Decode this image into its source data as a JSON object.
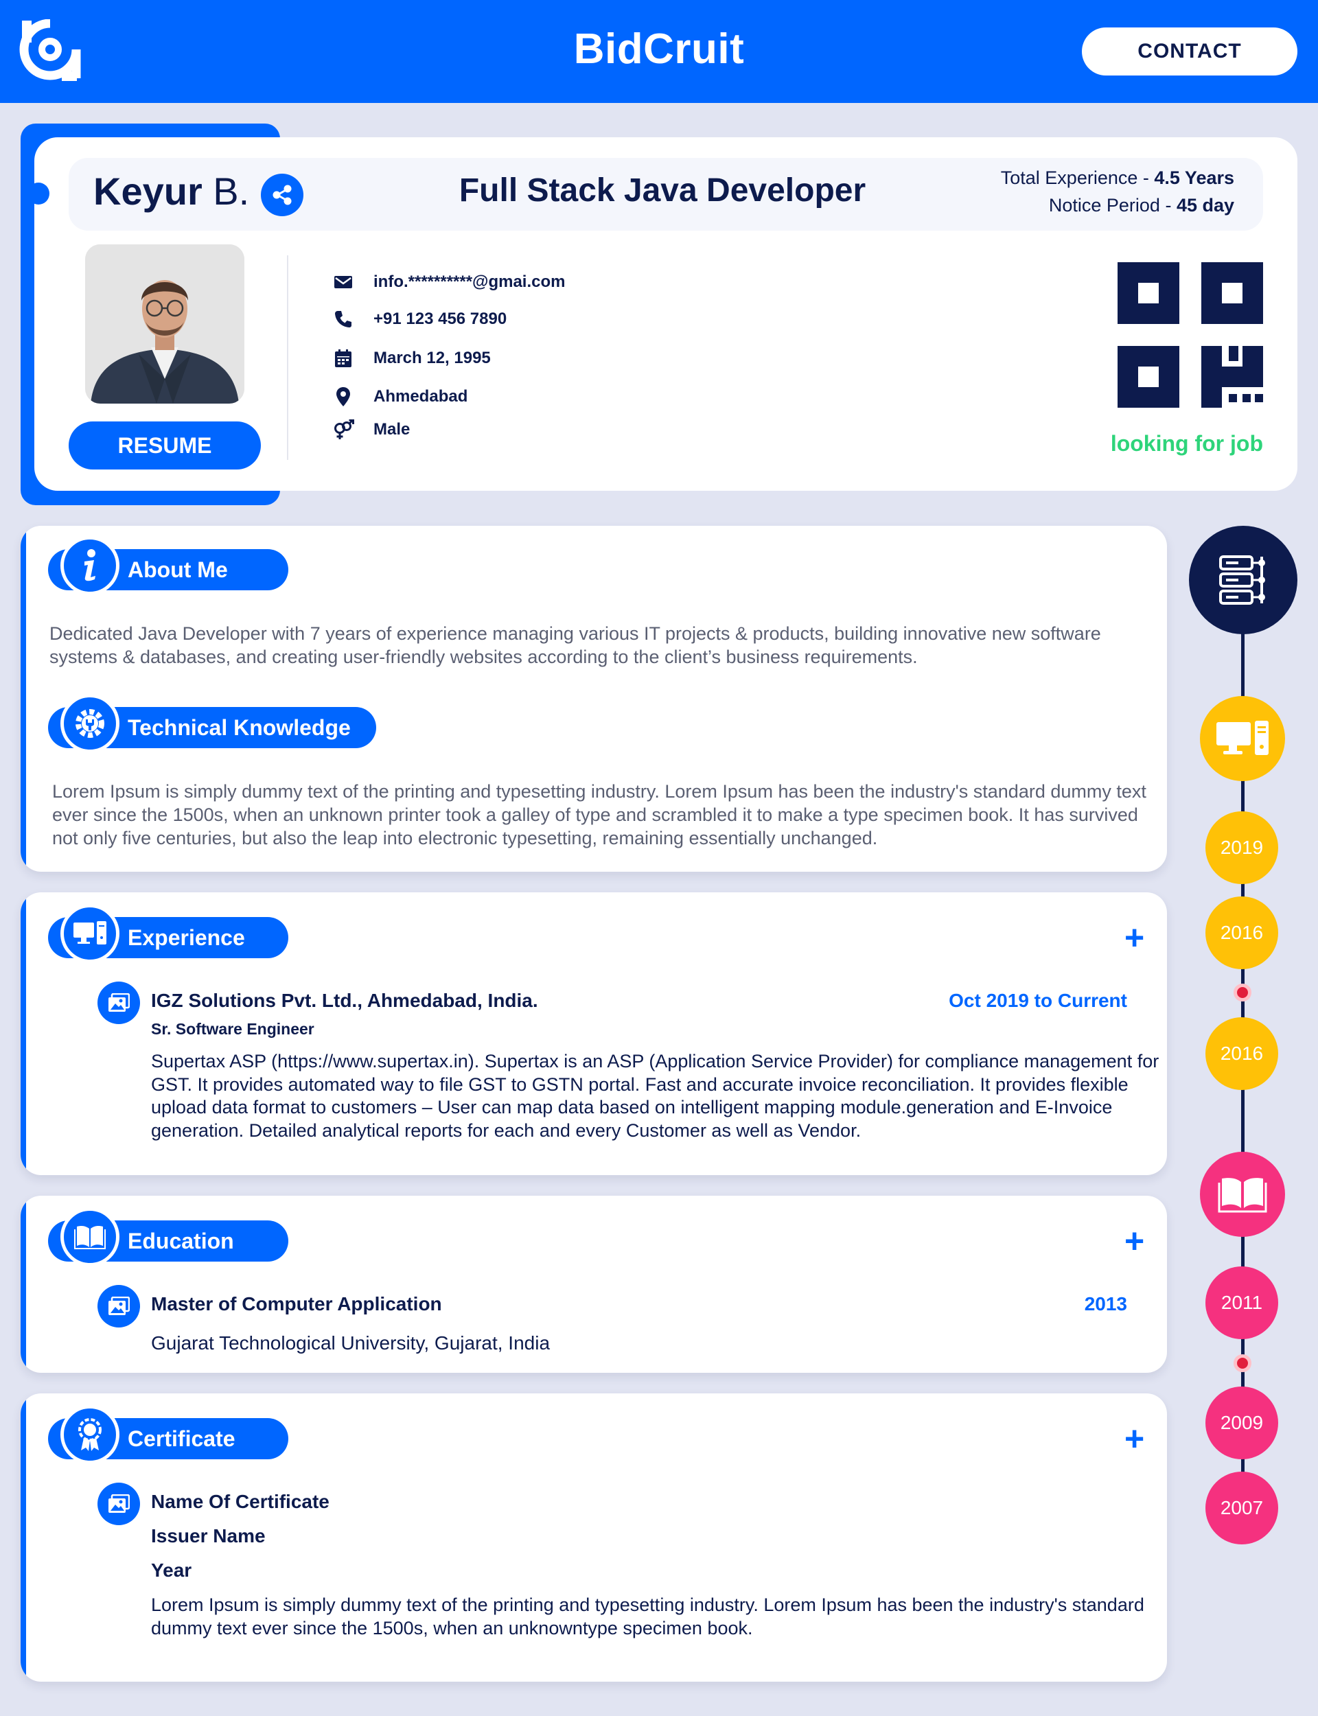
{
  "header": {
    "brand": "BidCruit",
    "contact_label": "CONTACT"
  },
  "profile": {
    "first_name": "Keyur",
    "last_initial": " B.",
    "title": "Full Stack Java Developer",
    "experience_label": "Total Experience - ",
    "experience_value": "4.5 Years",
    "notice_label": "Notice Period - ",
    "notice_value": "45 day",
    "email": "info.**********@gmai.com",
    "phone": "+91 123 456 7890",
    "dob": "March 12, 1995",
    "city": "Ahmedabad",
    "gender": "Male",
    "resume_label": "RESUME",
    "status": "looking for job"
  },
  "about": {
    "heading": "About Me",
    "text": "Dedicated Java Developer with 7 years of experience managing various IT projects & products, building innovative new software systems & databases, and creating user-friendly websites according to the client’s business requirements."
  },
  "technical": {
    "heading": "Technical Knowledge",
    "text": "Lorem Ipsum is simply dummy text of the printing and typesetting industry. Lorem Ipsum has been the industry's standard dummy text ever since the 1500s, when an unknown printer took a galley of type and scrambled it to make a type specimen book. It has survived not only five centuries, but also the leap into electronic typesetting, remaining essentially unchanged."
  },
  "experience": {
    "heading": "Experience",
    "add": "+",
    "company": "IGZ Solutions Pvt. Ltd., Ahmedabad, India.",
    "period": "Oct 2019 to Current",
    "position": "Sr. Software Engineer",
    "description": "Supertax ASP (https://www.supertax.in). Supertax is an ASP (Application Service Provider) for compliance management for GST. It provides automated way to file GST to GSTN portal. Fast and accurate invoice reconciliation. It provides flexible upload data format to customers – User can map data based on intelligent mapping module.generation and E-Invoice generation. Detailed analytical reports for each and every Customer as well as Vendor."
  },
  "education": {
    "heading": "Education",
    "add": "+",
    "degree": "Master of Computer Application",
    "year": "2013",
    "school": "Gujarat Technological University, Gujarat, India"
  },
  "certificate": {
    "heading": "Certificate",
    "add": "+",
    "name": "Name Of Certificate",
    "issuer": "Issuer Name",
    "year": "Year",
    "description": "Lorem Ipsum is simply dummy text of the printing and typesetting industry. Lorem Ipsum has been the industry's standard dummy text ever since the 1500s, when an unknowntype specimen book."
  },
  "timeline": {
    "years": [
      "2019",
      "2016",
      "2016",
      "2011",
      "2009",
      "2007"
    ]
  },
  "colors": {
    "primary": "#0066ff",
    "navy": "#0d1b4d",
    "background": "#e1e4f2",
    "yellow": "#ffc107",
    "pink": "#f5317f",
    "green": "#2ed47a"
  }
}
